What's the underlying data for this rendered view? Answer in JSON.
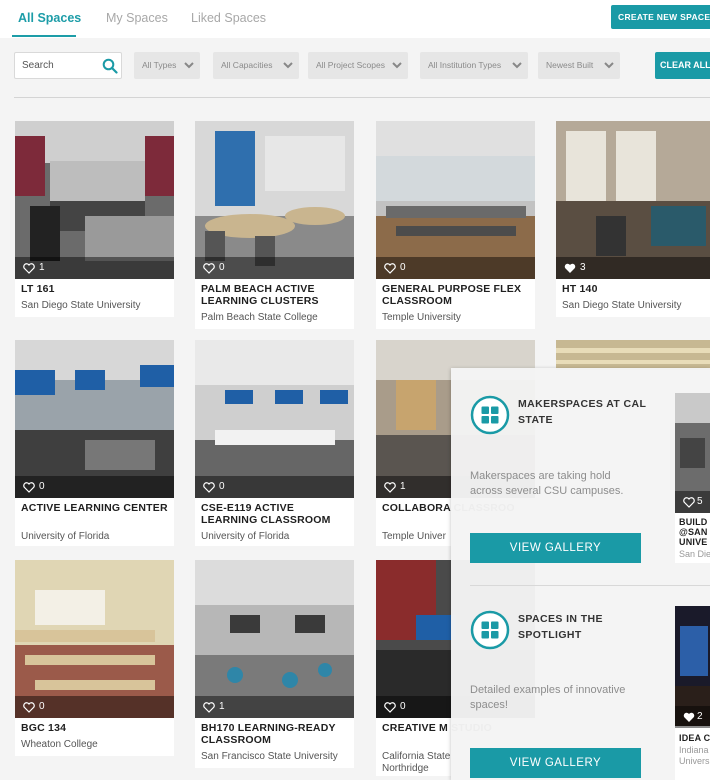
{
  "tabs": [
    {
      "label": "All Spaces",
      "active": true
    },
    {
      "label": "My Spaces",
      "active": false
    },
    {
      "label": "Liked Spaces",
      "active": false
    }
  ],
  "create_button": "CREATE NEW SPACE",
  "search": {
    "placeholder": "Search",
    "value": ""
  },
  "filters": [
    "All Types",
    "All Capacities",
    "All Project Scopes",
    "All Institution Types",
    "Newest Built"
  ],
  "clear_button": "CLEAR ALL",
  "colors": {
    "accent": "#1a9aa6",
    "panel_bg": "#f4f4f4"
  },
  "cards": [
    {
      "title": "LT 161",
      "subtitle": "San Diego State University",
      "likes": "1",
      "liked": false
    },
    {
      "title": "PALM BEACH ACTIVE LEARNING CLUSTERS",
      "subtitle": "Palm Beach State College",
      "likes": "0",
      "liked": false
    },
    {
      "title": "GENERAL PURPOSE FLEX CLASSROOM",
      "subtitle": "Temple University",
      "likes": "0",
      "liked": false
    },
    {
      "title": "HT 140",
      "subtitle": "San Diego State University",
      "likes": "3",
      "liked": true
    },
    {
      "title": "ACTIVE LEARNING CENTER",
      "subtitle": "University of Florida",
      "likes": "0",
      "liked": false
    },
    {
      "title": "CSE-E119 ACTIVE LEARNING CLASSROOM",
      "subtitle": "University of Florida",
      "likes": "0",
      "liked": false
    },
    {
      "title": "COLLABORA CLASSROO",
      "subtitle": "Temple Univer",
      "likes": "1",
      "liked": false
    },
    {
      "title": "BUILD @SAN UNIVE",
      "subtitle": "San Die",
      "likes": "5",
      "liked": false
    },
    {
      "title": "BGC 134",
      "subtitle": "Wheaton College",
      "likes": "0",
      "liked": false
    },
    {
      "title": "BH170 LEARNING-READY CLASSROOM",
      "subtitle": "San Francisco State University",
      "likes": "1",
      "liked": false
    },
    {
      "title": "CREATIVE M STUDIO",
      "subtitle": "California State Northridge",
      "likes": "0",
      "liked": false
    },
    {
      "title": "IDEA C",
      "subtitle": "Indiana Univers",
      "likes": "2",
      "liked": true
    }
  ],
  "galleries": [
    {
      "title": "MAKERSPACES AT CAL STATE",
      "description": "Makerspaces are taking hold across several CSU campuses.",
      "button": "VIEW GALLERY",
      "icon": "grid-icon"
    },
    {
      "title": "SPACES IN THE SPOTLIGHT",
      "description": "Detailed examples of innovative spaces!",
      "button": "VIEW GALLERY",
      "icon": "grid-icon"
    }
  ]
}
